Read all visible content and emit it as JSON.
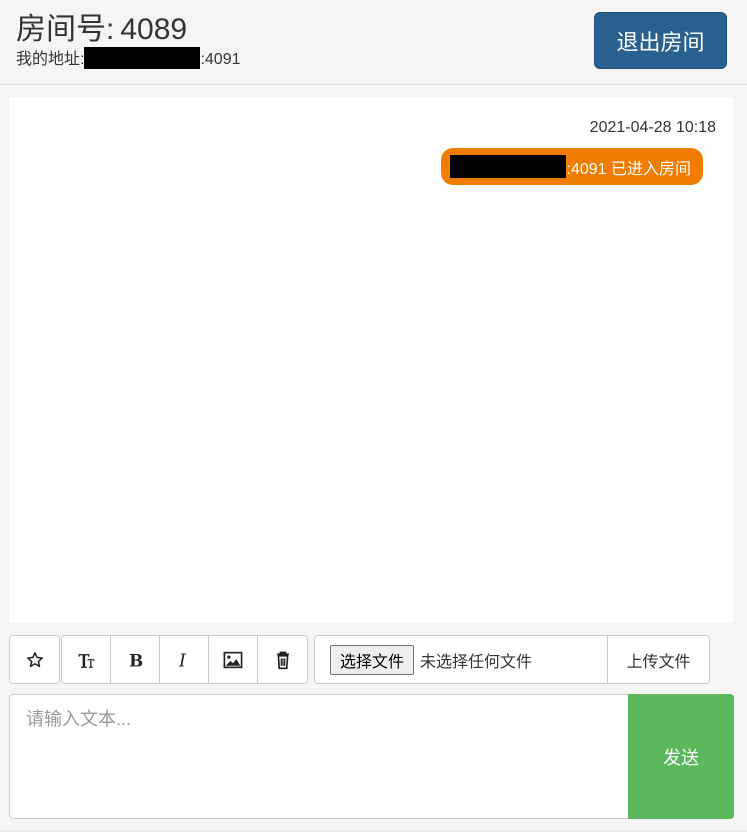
{
  "header": {
    "room_label": "房间号:",
    "room_number": "4089",
    "address_label": "我的地址:",
    "address_port": ":4091",
    "exit_button": "退出房间"
  },
  "chat": {
    "messages": [
      {
        "time": "2021-04-28 10:18",
        "text": ":4091 已进入房间",
        "bubble_color": "#f07c00"
      }
    ]
  },
  "toolbar": {
    "icons": [
      "star-icon",
      "text-size-icon",
      "bold-icon",
      "italic-icon",
      "image-icon",
      "trash-icon"
    ]
  },
  "file_upload": {
    "choose_label": "选择文件",
    "no_file_text": "未选择任何文件",
    "upload_label": "上传文件"
  },
  "composer": {
    "placeholder": "请输入文本...",
    "send_label": "发送",
    "send_color": "#5cb85c"
  },
  "colors": {
    "exit_button": "#286090",
    "accent_orange": "#f07c00",
    "send_green": "#5cb85c"
  }
}
